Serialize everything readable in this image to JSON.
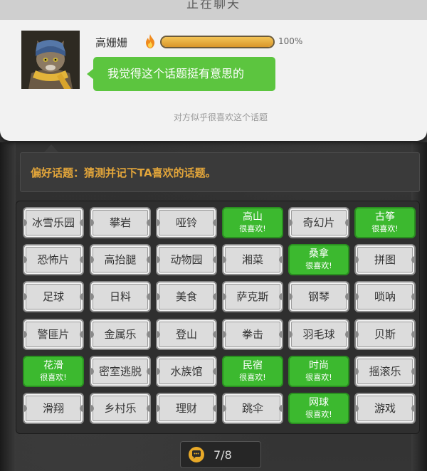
{
  "chat": {
    "header_title": "正在聊天",
    "name": "高姗姗",
    "affinity_percent": 100,
    "affinity_label": "100%",
    "message": "我觉得这个话题挺有意思的",
    "hint": "对方似乎很喜欢这个话题"
  },
  "topic": {
    "instruction": "偏好话题：猜测并记下TA喜欢的话题。"
  },
  "liked_label": "很喜欢!",
  "tags": [
    {
      "label": "冰雪乐园",
      "liked": false
    },
    {
      "label": "攀岩",
      "liked": false
    },
    {
      "label": "哑铃",
      "liked": false
    },
    {
      "label": "高山",
      "liked": true
    },
    {
      "label": "奇幻片",
      "liked": false
    },
    {
      "label": "古筝",
      "liked": true
    },
    {
      "label": "恐怖片",
      "liked": false
    },
    {
      "label": "高抬腿",
      "liked": false
    },
    {
      "label": "动物园",
      "liked": false
    },
    {
      "label": "湘菜",
      "liked": false
    },
    {
      "label": "桑拿",
      "liked": true
    },
    {
      "label": "拼图",
      "liked": false
    },
    {
      "label": "足球",
      "liked": false
    },
    {
      "label": "日料",
      "liked": false
    },
    {
      "label": "美食",
      "liked": false
    },
    {
      "label": "萨克斯",
      "liked": false
    },
    {
      "label": "钢琴",
      "liked": false
    },
    {
      "label": "唢呐",
      "liked": false
    },
    {
      "label": "警匪片",
      "liked": false
    },
    {
      "label": "金属乐",
      "liked": false
    },
    {
      "label": "登山",
      "liked": false
    },
    {
      "label": "拳击",
      "liked": false
    },
    {
      "label": "羽毛球",
      "liked": false
    },
    {
      "label": "贝斯",
      "liked": false
    },
    {
      "label": "花滑",
      "liked": true
    },
    {
      "label": "密室逃脱",
      "liked": false
    },
    {
      "label": "水族馆",
      "liked": false
    },
    {
      "label": "民宿",
      "liked": true
    },
    {
      "label": "时尚",
      "liked": true
    },
    {
      "label": "摇滚乐",
      "liked": false
    },
    {
      "label": "滑翔",
      "liked": false
    },
    {
      "label": "乡村乐",
      "liked": false
    },
    {
      "label": "理财",
      "liked": false
    },
    {
      "label": "跳伞",
      "liked": false
    },
    {
      "label": "网球",
      "liked": true
    },
    {
      "label": "游戏",
      "liked": false
    }
  ],
  "counter": {
    "text": "7/8",
    "icon": "chat-bubble-icon"
  },
  "colors": {
    "liked_green": "#3cb92f",
    "instruction_orange": "#e2a53a",
    "bubble_green": "#5cc53f"
  }
}
